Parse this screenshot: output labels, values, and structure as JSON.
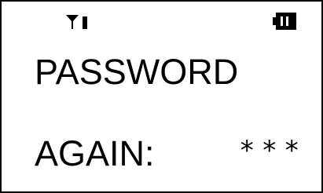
{
  "status": {
    "signal_icon": "signal-antenna-icon",
    "battery_icon": "battery-full-icon"
  },
  "prompt": {
    "line1": "PASSWORD",
    "line2": "AGAIN:"
  },
  "input": {
    "masked_value": "***"
  }
}
